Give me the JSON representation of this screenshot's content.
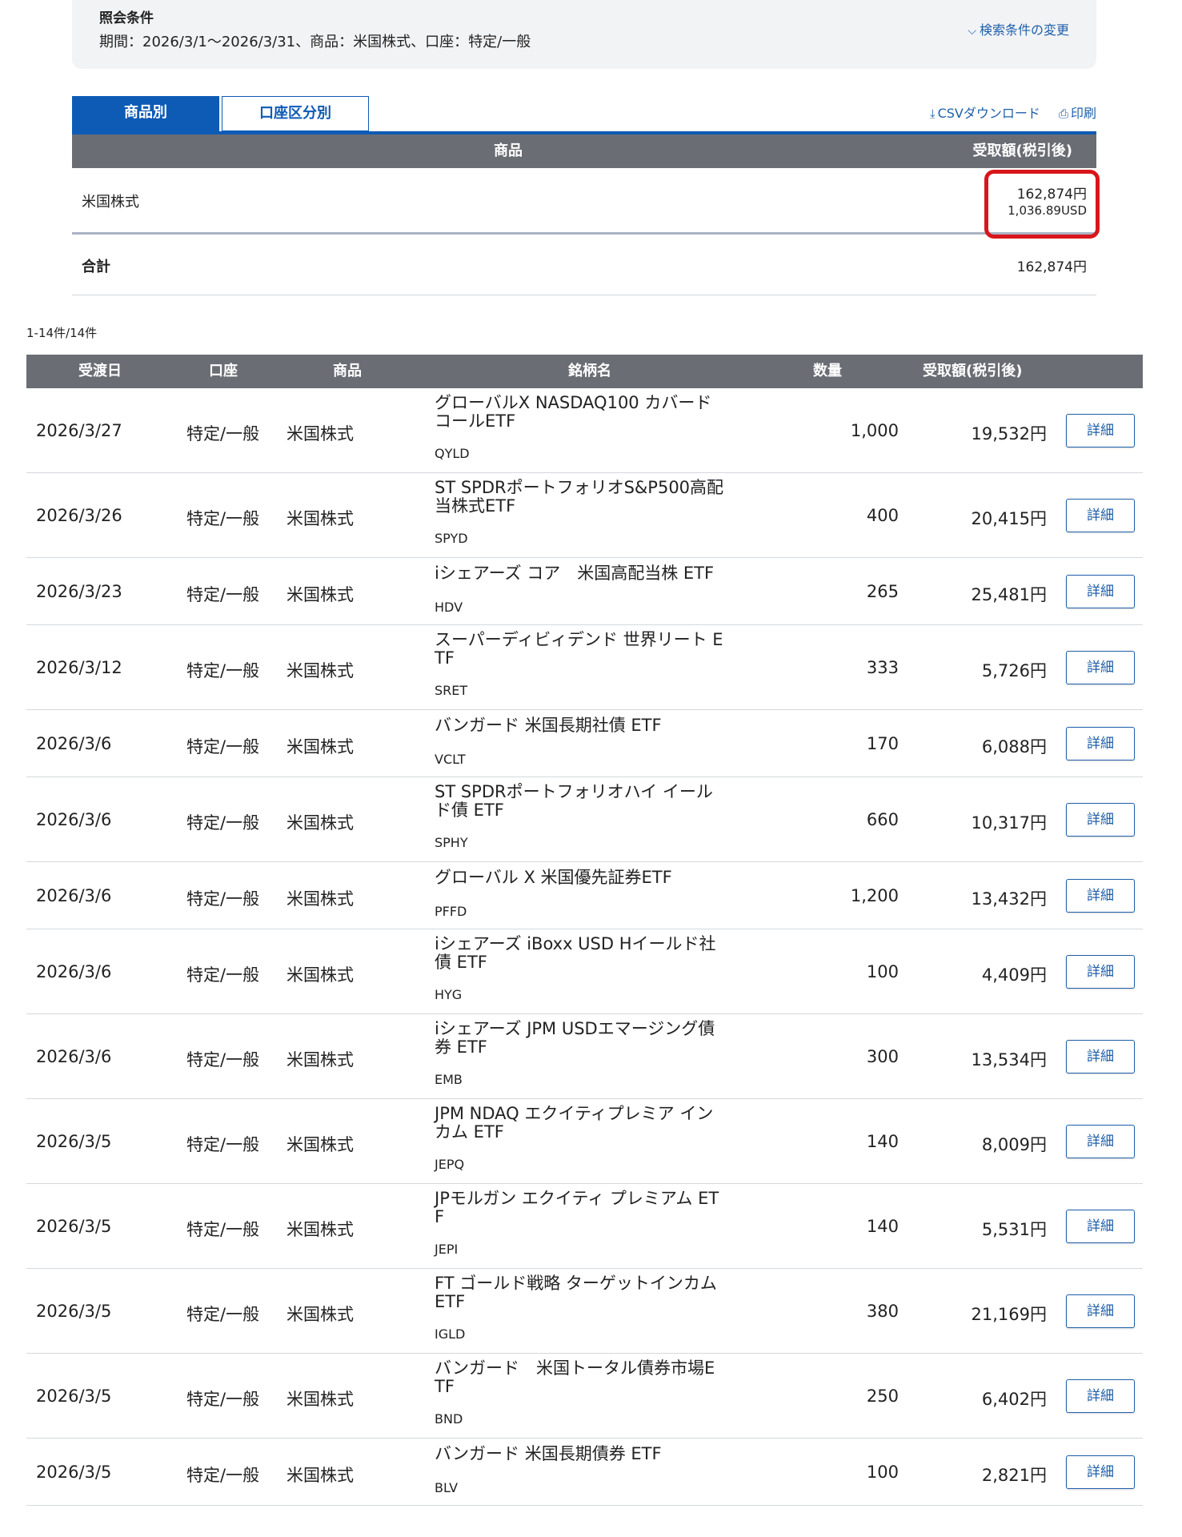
{
  "conditions": {
    "title": "照会条件",
    "text": "期間：2026/3/1〜2026/3/31、商品：米国株式、口座：特定/一般",
    "change_link": "検索条件の変更"
  },
  "tabs": {
    "by_product": "商品別",
    "by_account": "口座区分別"
  },
  "tools": {
    "csv": "CSVダウンロード",
    "print": "印刷"
  },
  "summary": {
    "col_product": "商品",
    "col_amount": "受取額(税引後)",
    "row_label": "米国株式",
    "row_jpy": "162,874円",
    "row_usd": "1,036.89USD",
    "total_label": "合計",
    "total_value": "162,874円"
  },
  "count_text": "1-14件/14件",
  "list": {
    "headers": {
      "date": "受渡日",
      "account": "口座",
      "product": "商品",
      "name": "銘柄名",
      "qty": "数量",
      "amount": "受取額(税引後)"
    },
    "detail_label": "詳細",
    "rows": [
      {
        "date": "2026/3/27",
        "account": "特定/一般",
        "product": "米国株式",
        "name1": "グローバルX NASDAQ100 カバード",
        "name2": "コールETF",
        "code": "QYLD",
        "qty": "1,000",
        "amount": "19,532円"
      },
      {
        "date": "2026/3/26",
        "account": "特定/一般",
        "product": "米国株式",
        "name1": "ST SPDRポートフォリオS&P500高配",
        "name2": "当株式ETF",
        "code": "SPYD",
        "qty": "400",
        "amount": "20,415円"
      },
      {
        "date": "2026/3/23",
        "account": "特定/一般",
        "product": "米国株式",
        "name1": "iシェアーズ コア　米国高配当株 ETF",
        "name2": "",
        "code": "HDV",
        "qty": "265",
        "amount": "25,481円"
      },
      {
        "date": "2026/3/12",
        "account": "特定/一般",
        "product": "米国株式",
        "name1": "スーパーディビィデンド 世界リート E",
        "name2": "TF",
        "code": "SRET",
        "qty": "333",
        "amount": "5,726円"
      },
      {
        "date": "2026/3/6",
        "account": "特定/一般",
        "product": "米国株式",
        "name1": "バンガード 米国長期社債 ETF",
        "name2": "",
        "code": "VCLT",
        "qty": "170",
        "amount": "6,088円"
      },
      {
        "date": "2026/3/6",
        "account": "特定/一般",
        "product": "米国株式",
        "name1": "ST SPDRポートフォリオハイ イール",
        "name2": "ド債 ETF",
        "code": "SPHY",
        "qty": "660",
        "amount": "10,317円"
      },
      {
        "date": "2026/3/6",
        "account": "特定/一般",
        "product": "米国株式",
        "name1": "グローバル X 米国優先証券ETF",
        "name2": "",
        "code": "PFFD",
        "qty": "1,200",
        "amount": "13,432円"
      },
      {
        "date": "2026/3/6",
        "account": "特定/一般",
        "product": "米国株式",
        "name1": "iシェアーズ iBoxx USD Hイールド社",
        "name2": "債 ETF",
        "code": "HYG",
        "qty": "100",
        "amount": "4,409円"
      },
      {
        "date": "2026/3/6",
        "account": "特定/一般",
        "product": "米国株式",
        "name1": "iシェアーズ JPM USDエマージング債",
        "name2": "券 ETF",
        "code": "EMB",
        "qty": "300",
        "amount": "13,534円"
      },
      {
        "date": "2026/3/5",
        "account": "特定/一般",
        "product": "米国株式",
        "name1": "JPM NDAQ エクイティプレミア イン",
        "name2": "カム ETF",
        "code": "JEPQ",
        "qty": "140",
        "amount": "8,009円"
      },
      {
        "date": "2026/3/5",
        "account": "特定/一般",
        "product": "米国株式",
        "name1": "JPモルガン エクイティ プレミアム ET",
        "name2": "F",
        "code": "JEPI",
        "qty": "140",
        "amount": "5,531円"
      },
      {
        "date": "2026/3/5",
        "account": "特定/一般",
        "product": "米国株式",
        "name1": "FT ゴールド戦略 ターゲットインカム",
        "name2": "ETF",
        "code": "IGLD",
        "qty": "380",
        "amount": "21,169円"
      },
      {
        "date": "2026/3/5",
        "account": "特定/一般",
        "product": "米国株式",
        "name1": "バンガード　米国トータル債券市場E",
        "name2": "TF",
        "code": "BND",
        "qty": "250",
        "amount": "6,402円"
      },
      {
        "date": "2026/3/5",
        "account": "特定/一般",
        "product": "米国株式",
        "name1": "バンガード 米国長期債券 ETF",
        "name2": "",
        "code": "BLV",
        "qty": "100",
        "amount": "2,821円"
      }
    ]
  }
}
